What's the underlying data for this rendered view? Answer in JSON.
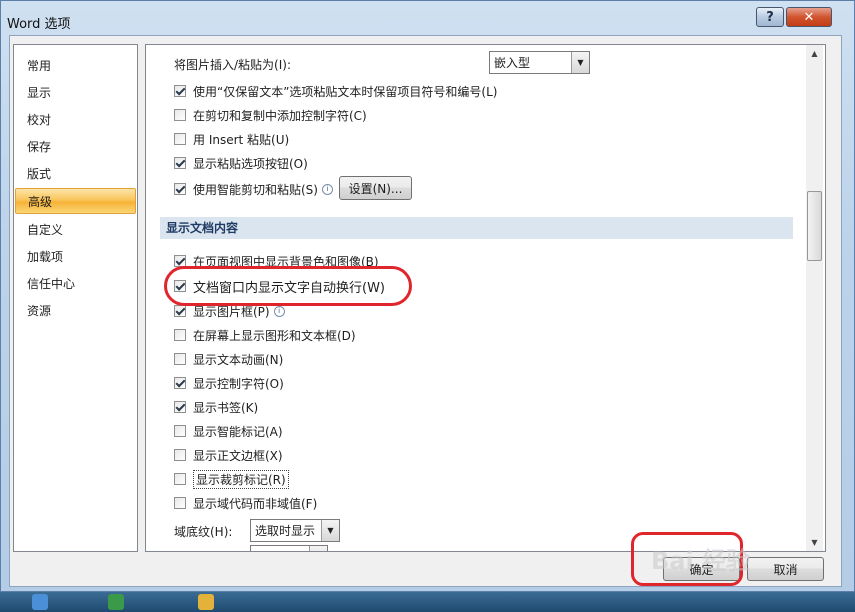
{
  "window": {
    "title": "Word 选项",
    "help": "?",
    "close": "✕"
  },
  "nav": {
    "items": [
      {
        "label": "常用"
      },
      {
        "label": "显示"
      },
      {
        "label": "校对"
      },
      {
        "label": "保存"
      },
      {
        "label": "版式"
      },
      {
        "label": "高级",
        "selected": true
      },
      {
        "label": "自定义"
      },
      {
        "label": "加载项"
      },
      {
        "label": "信任中心"
      },
      {
        "label": "资源"
      }
    ]
  },
  "paste": {
    "insert_label": "将图片插入/粘贴为(I):",
    "insert_value": "嵌入型",
    "options": [
      {
        "label": "使用“仅保留文本”选项粘贴文本时保留项目符号和编号(L)",
        "checked": true
      },
      {
        "label": "在剪切和复制中添加控制字符(C)",
        "checked": false
      },
      {
        "label": "用 Insert 粘贴(U)",
        "checked": false
      },
      {
        "label": "显示粘贴选项按钮(O)",
        "checked": true
      },
      {
        "label": "使用智能剪切和粘贴(S)",
        "checked": true
      }
    ],
    "settings_button": "设置(N)..."
  },
  "section_title": "显示文档内容",
  "display": {
    "options": [
      {
        "label": "在页面视图中显示背景色和图像(B)",
        "checked": true
      },
      {
        "label": "文档窗口内显示文字自动换行(W)",
        "checked": true
      },
      {
        "label": "显示图片框(P)",
        "checked": true
      },
      {
        "label": "在屏幕上显示图形和文本框(D)",
        "checked": false
      },
      {
        "label": "显示文本动画(N)",
        "checked": false
      },
      {
        "label": "显示控制字符(O)",
        "checked": true
      },
      {
        "label": "显示书签(K)",
        "checked": true
      },
      {
        "label": "显示智能标记(A)",
        "checked": false
      },
      {
        "label": "显示正文边框(X)",
        "checked": false
      },
      {
        "label": "显示裁剪标记(R)",
        "checked": false
      },
      {
        "label": "显示域代码而非域值(F)",
        "checked": false
      }
    ],
    "shading_label": "域底纹(H):",
    "shading_value": "选取时显示"
  },
  "footer": {
    "ok": "确定",
    "cancel": "取消"
  },
  "watermark": "Bai 经验"
}
